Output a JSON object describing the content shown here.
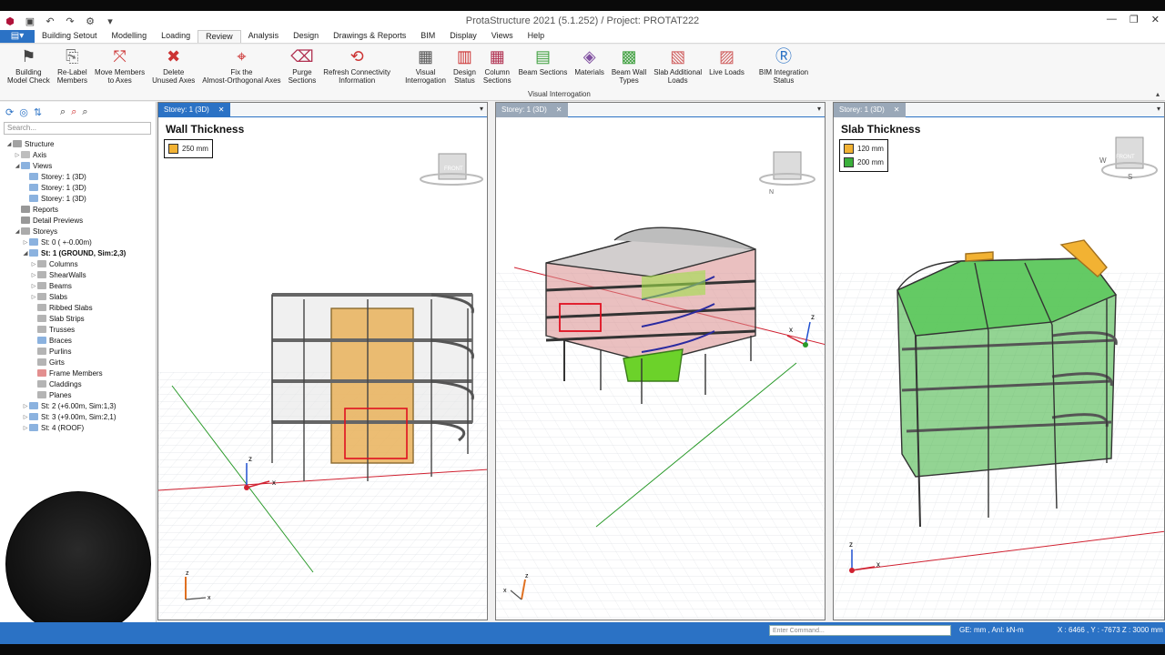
{
  "window": {
    "title": "ProtaStructure 2021 (5.1.252) / Project: PROTAT222",
    "min": "—",
    "max": "❐",
    "close": "✕"
  },
  "menu": {
    "tabs": [
      "Building Setout",
      "Modelling",
      "Loading",
      "Review",
      "Analysis",
      "Design",
      "Drawings & Reports",
      "BIM",
      "Display",
      "Views",
      "Help"
    ],
    "active": "Review"
  },
  "ribbon": {
    "buttons": [
      {
        "label": "Building\nModel Check",
        "icon": "model-check-icon"
      },
      {
        "label": "Re-Label\nMembers",
        "icon": "relabel-icon"
      },
      {
        "label": "Move Members\nto Axes",
        "icon": "move-members-icon"
      },
      {
        "label": "Delete\nUnused Axes",
        "icon": "delete-axes-icon"
      },
      {
        "label": "Fix the\nAlmost-Orthogonal Axes",
        "icon": "fix-axes-icon"
      },
      {
        "label": "Purge\nSections",
        "icon": "purge-icon"
      },
      {
        "label": "Refresh Connectivity\nInformation",
        "icon": "refresh-connectivity-icon"
      },
      {
        "label": "Visual\nInterrogation",
        "icon": "visual-interrogation-icon"
      },
      {
        "label": "Design\nStatus",
        "icon": "design-status-icon"
      },
      {
        "label": "Column\nSections",
        "icon": "column-sections-icon"
      },
      {
        "label": "Beam Sections",
        "icon": "beam-sections-icon"
      },
      {
        "label": "Materials",
        "icon": "materials-icon"
      },
      {
        "label": "Beam Wall\nTypes",
        "icon": "beam-wall-types-icon"
      },
      {
        "label": "Slab Additional\nLoads",
        "icon": "slab-loads-icon"
      },
      {
        "label": "Live Loads",
        "icon": "live-loads-icon"
      },
      {
        "label": "BIM Integration\nStatus",
        "icon": "bim-status-icon"
      }
    ],
    "group_label": "Visual Interrogation"
  },
  "tree": {
    "search_placeholder": "Search...",
    "nodes": [
      {
        "label": "Structure",
        "depth": 0,
        "arrow": "◢",
        "bold": false,
        "icon": "structure-icon"
      },
      {
        "label": "Axis",
        "depth": 1,
        "arrow": "▷",
        "bold": false,
        "icon": "axis-icon"
      },
      {
        "label": "Views",
        "depth": 1,
        "arrow": "◢",
        "bold": false,
        "icon": "views-icon"
      },
      {
        "label": "Storey: 1 (3D)",
        "depth": 2,
        "arrow": "",
        "bold": false,
        "icon": "view-3d-icon"
      },
      {
        "label": "Storey: 1 (3D)",
        "depth": 2,
        "arrow": "",
        "bold": false,
        "icon": "view-3d-icon"
      },
      {
        "label": "Storey: 1 (3D)",
        "depth": 2,
        "arrow": "",
        "bold": false,
        "icon": "view-3d-icon"
      },
      {
        "label": "Reports",
        "depth": 1,
        "arrow": "",
        "bold": false,
        "icon": "reports-icon"
      },
      {
        "label": "Detail Previews",
        "depth": 1,
        "arrow": "",
        "bold": false,
        "icon": "detail-previews-icon"
      },
      {
        "label": "Storeys",
        "depth": 1,
        "arrow": "◢",
        "bold": false,
        "icon": "storeys-icon"
      },
      {
        "label": "St: 0 ( +-0.00m)",
        "depth": 2,
        "arrow": "▷",
        "bold": false,
        "icon": "storey-icon"
      },
      {
        "label": "St: 1 (GROUND, Sim:2,3)",
        "depth": 2,
        "arrow": "◢",
        "bold": true,
        "icon": "storey-icon"
      },
      {
        "label": "Columns",
        "depth": 3,
        "arrow": "▷",
        "bold": false,
        "icon": "columns-icon"
      },
      {
        "label": "ShearWalls",
        "depth": 3,
        "arrow": "▷",
        "bold": false,
        "icon": "shearwalls-icon"
      },
      {
        "label": "Beams",
        "depth": 3,
        "arrow": "▷",
        "bold": false,
        "icon": "beams-icon"
      },
      {
        "label": "Slabs",
        "depth": 3,
        "arrow": "▷",
        "bold": false,
        "icon": "slabs-icon"
      },
      {
        "label": "Ribbed Slabs",
        "depth": 3,
        "arrow": "",
        "bold": false,
        "icon": "ribbed-slabs-icon"
      },
      {
        "label": "Slab Strips",
        "depth": 3,
        "arrow": "",
        "bold": false,
        "icon": "slab-strips-icon"
      },
      {
        "label": "Trusses",
        "depth": 3,
        "arrow": "",
        "bold": false,
        "icon": "trusses-icon"
      },
      {
        "label": "Braces",
        "depth": 3,
        "arrow": "",
        "bold": false,
        "icon": "braces-icon"
      },
      {
        "label": "Purlins",
        "depth": 3,
        "arrow": "",
        "bold": false,
        "icon": "purlins-icon"
      },
      {
        "label": "Girts",
        "depth": 3,
        "arrow": "",
        "bold": false,
        "icon": "girts-icon"
      },
      {
        "label": "Frame Members",
        "depth": 3,
        "arrow": "",
        "bold": false,
        "icon": "frame-members-icon"
      },
      {
        "label": "Claddings",
        "depth": 3,
        "arrow": "",
        "bold": false,
        "icon": "claddings-icon"
      },
      {
        "label": "Planes",
        "depth": 3,
        "arrow": "",
        "bold": false,
        "icon": "planes-icon"
      },
      {
        "label": "St: 2 (+6.00m, Sim:1,3)",
        "depth": 2,
        "arrow": "▷",
        "bold": false,
        "icon": "storey-icon"
      },
      {
        "label": "St: 3 (+9.00m, Sim:2,1)",
        "depth": 2,
        "arrow": "▷",
        "bold": false,
        "icon": "storey-icon"
      },
      {
        "label": "St: 4 (ROOF)",
        "depth": 2,
        "arrow": "▷",
        "bold": false,
        "icon": "storey-icon"
      }
    ]
  },
  "viewports": [
    {
      "tab": "Storey: 1 (3D)",
      "close": "✕",
      "active": true,
      "legend_title": "Wall Thickness",
      "legend": [
        {
          "label": "250 mm",
          "color": "#f2b233"
        }
      ]
    },
    {
      "tab": "Storey: 1 (3D)",
      "close": "✕",
      "active": false,
      "legend_title": "",
      "legend": []
    },
    {
      "tab": "Storey: 1 (3D)",
      "close": "✕",
      "active": false,
      "legend_title": "Slab Thickness",
      "legend": [
        {
          "label": "120 mm",
          "color": "#f2b233"
        },
        {
          "label": "200 mm",
          "color": "#3bb03b"
        }
      ]
    }
  ],
  "viewcube": {
    "front": "FRONT",
    "top": "TOP",
    "south": "S",
    "west": "W",
    "north": "N"
  },
  "axes": {
    "x": "x",
    "y": "y",
    "z": "z"
  },
  "status": {
    "command_placeholder": "Enter Command...",
    "units": "GE: mm , Anl: kN-m",
    "coords": "X : 6466 , Y : -7673    Z : 3000 mm"
  },
  "colors": {
    "accent": "#2b72c5",
    "wall": "#f2b233",
    "slab_thin": "#f2b233",
    "slab_thick": "#3bb03b"
  }
}
